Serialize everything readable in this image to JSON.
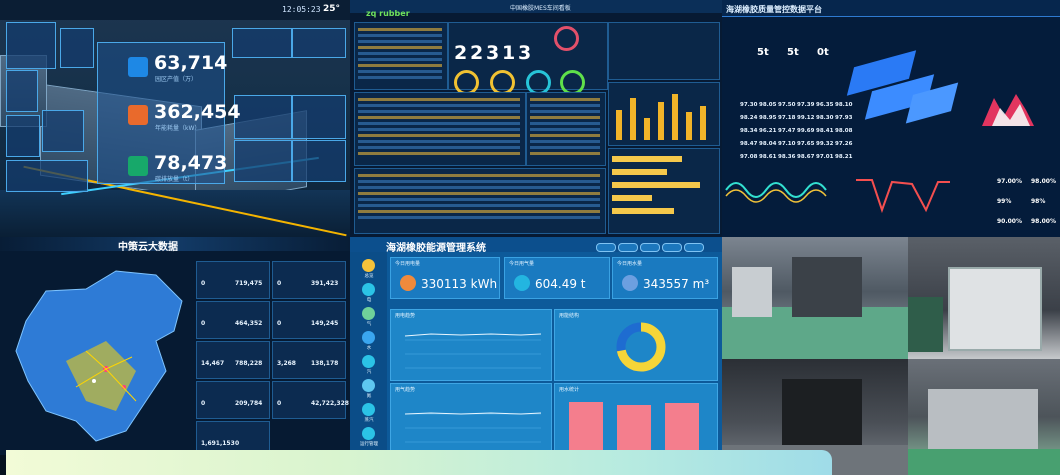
{
  "factory_3d": {
    "time": "12:05:23",
    "temperature": "25°",
    "kpis": [
      {
        "value": "63,714",
        "label": "园区产值（万）"
      },
      {
        "value": "362,454",
        "label": "年能耗量（kW）"
      },
      {
        "value": "78,473",
        "label": "碳排放量（t）"
      }
    ]
  },
  "control_room": {
    "brand": "zq rubber",
    "title": "中国橡胶MES车间看板",
    "counter": [
      "2",
      "2",
      "3",
      "1",
      "3"
    ]
  },
  "digital_twin": {
    "title": "海湖橡胶质量管控数据平台",
    "stats": [
      "5t",
      "5t",
      "0t"
    ],
    "table_rows": [
      [
        "97.30",
        "98.05",
        "97.50",
        "97.39",
        "96.35",
        "98.10"
      ],
      [
        "98.24",
        "98.95",
        "97.18",
        "99.12",
        "98.30",
        "97.93"
      ],
      [
        "98.34",
        "96.21",
        "97.47",
        "99.69",
        "98.41",
        "98.08"
      ],
      [
        "98.47",
        "98.04",
        "97.10",
        "97.65",
        "99.32",
        "97.26"
      ],
      [
        "97.08",
        "98.61",
        "98.36",
        "98.67",
        "97.01",
        "98.21"
      ]
    ],
    "percents": [
      "97.00%",
      "98.00%",
      "99%",
      "98%",
      "90.00%",
      "98.00%"
    ]
  },
  "cloud_bigdata": {
    "title": "中策云大数据",
    "cells": [
      [
        "0",
        "719,475"
      ],
      [
        "0",
        "391,423"
      ],
      [
        "0",
        "464,352"
      ],
      [
        "0",
        "149,245"
      ],
      [
        "14,467",
        "788,228"
      ],
      [
        "3,268",
        "138,178"
      ],
      [
        "0",
        "209,784"
      ],
      [
        "0",
        "42,722,328"
      ],
      [
        "1,691,153",
        "0"
      ]
    ]
  },
  "energy_system": {
    "title": "海湖橡胶能源管理系统",
    "header_chips": [
      "数据总览",
      "厂区",
      "设备能耗",
      "能耗报表",
      "能耗分析"
    ],
    "kpis": [
      {
        "label": "今日用电量",
        "value": "330113 kWh",
        "color": "#f08a3c"
      },
      {
        "label": "今日用气量",
        "value": "604.49 t",
        "color": "#23b5e0"
      },
      {
        "label": "今日用水量",
        "value": "343557 m³",
        "color": "#6c9fe0"
      }
    ],
    "sidebar_items": [
      "总览",
      "电",
      "气",
      "水",
      "汽",
      "氮",
      "蒸汽",
      "运行管理"
    ],
    "chart_titles": [
      "用电趋势",
      "用能结构",
      "用气趋势",
      "用水统计"
    ],
    "donut_percent": 0.72,
    "bar_values": [
      0.92,
      0.86,
      0.9
    ],
    "colors": {
      "bar": "#f47e8d",
      "donut_a": "#f5d538",
      "donut_b": "#1e6cd1"
    }
  }
}
